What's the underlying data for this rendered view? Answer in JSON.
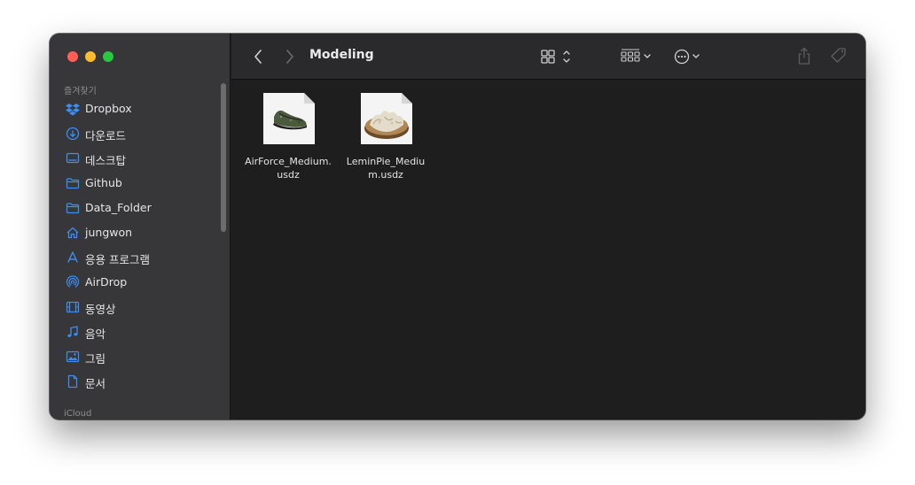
{
  "window": {
    "title": "Modeling"
  },
  "colors": {
    "red": "#ff5f57",
    "yellow": "#febc2e",
    "green": "#28c840",
    "accent": "#3b8ef5"
  },
  "sidebar": {
    "favorites_header": "즐겨찾기",
    "icloud_header": "iCloud",
    "items": [
      {
        "label": "Dropbox",
        "icon": "dropbox-icon"
      },
      {
        "label": "다운로드",
        "icon": "download-icon"
      },
      {
        "label": "데스크탑",
        "icon": "desktop-icon"
      },
      {
        "label": "Github",
        "icon": "folder-icon"
      },
      {
        "label": "Data_Folder",
        "icon": "folder-icon"
      },
      {
        "label": "jungwon",
        "icon": "home-icon"
      },
      {
        "label": "응용 프로그램",
        "icon": "applications-icon"
      },
      {
        "label": "AirDrop",
        "icon": "airdrop-icon"
      },
      {
        "label": "동영상",
        "icon": "film-icon"
      },
      {
        "label": "음악",
        "icon": "music-icon"
      },
      {
        "label": "그림",
        "icon": "photo-icon"
      },
      {
        "label": "문서",
        "icon": "document-icon"
      }
    ]
  },
  "toolbar": {
    "back": "back-icon",
    "forward": "forward-icon",
    "view": "grid-view-icon",
    "group": "group-icon",
    "more": "more-icon",
    "share": "share-icon",
    "tags": "tag-icon",
    "search": "search-icon"
  },
  "files": [
    {
      "name": "AirForce_Medium.usdz",
      "line1": "AirForce_Medium.",
      "line2": "usdz",
      "thumb": "sneaker-thumbnail"
    },
    {
      "name": "LeminPie_Medium.usdz",
      "line1": "LeminPie_Mediu",
      "line2": "m.usdz",
      "thumb": "pie-thumbnail"
    }
  ]
}
